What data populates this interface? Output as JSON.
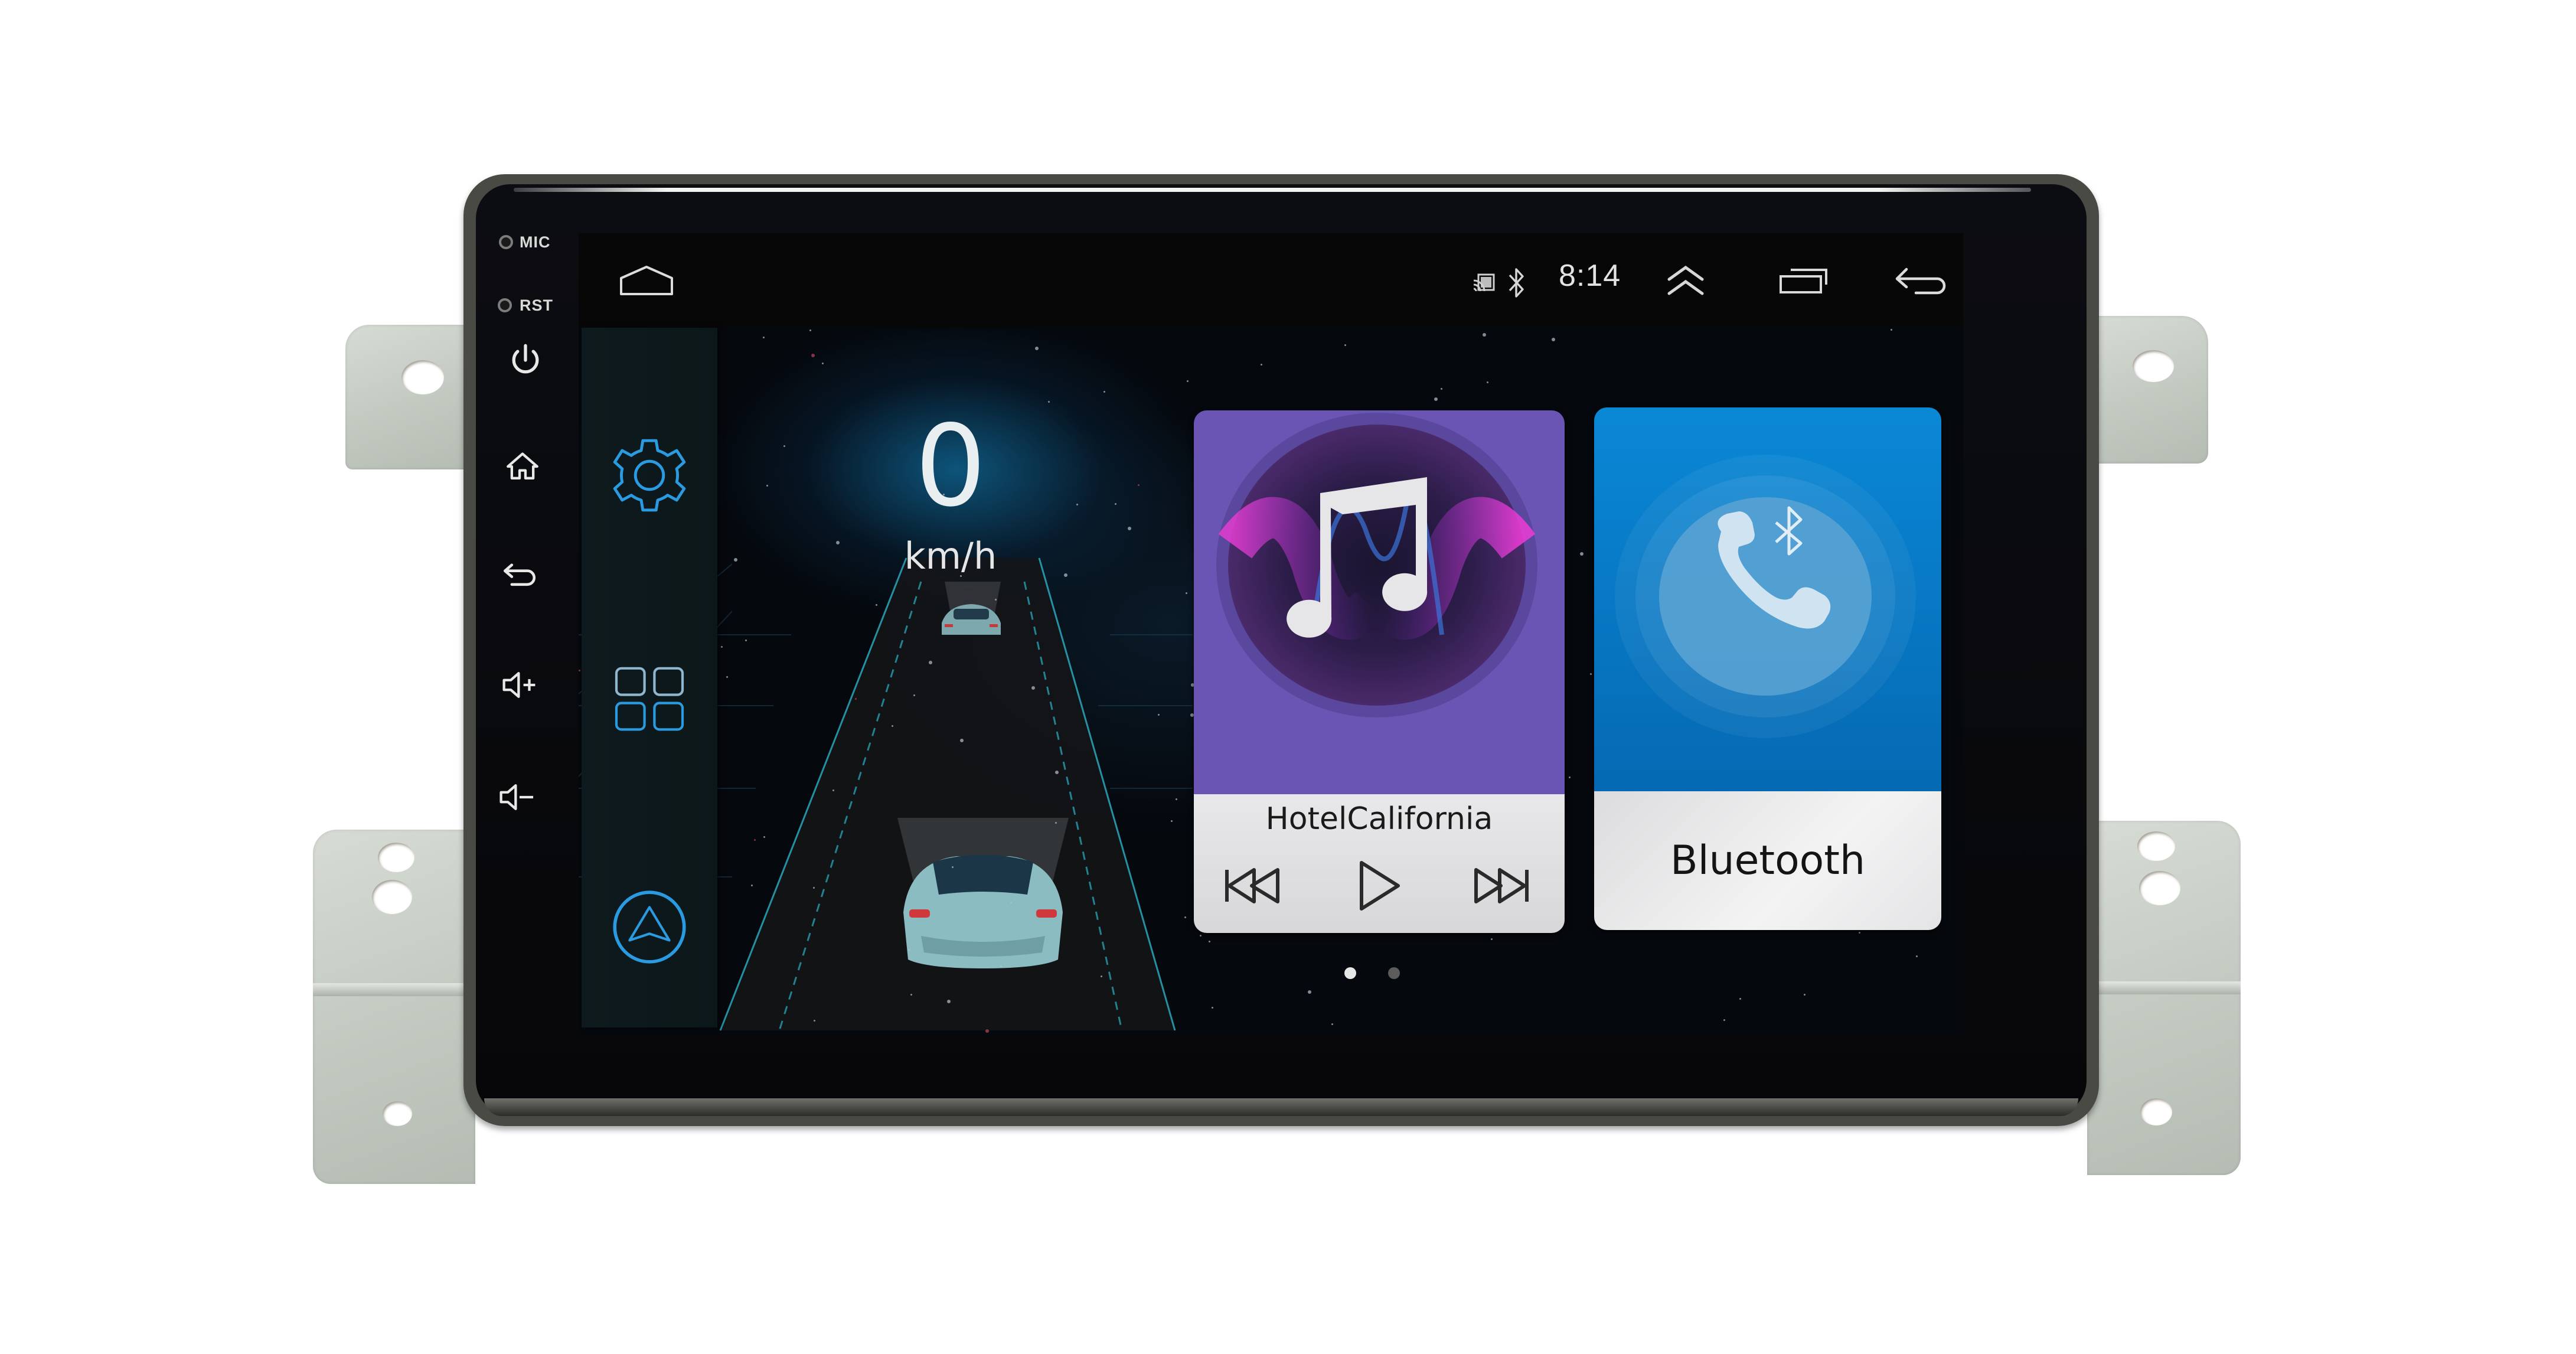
{
  "bezel": {
    "mic_label": "MIC",
    "rst_label": "RST",
    "buttons": [
      {
        "name": "power",
        "icon": "power-icon"
      },
      {
        "name": "home",
        "icon": "home-icon"
      },
      {
        "name": "back",
        "icon": "back-icon"
      },
      {
        "name": "volume-up",
        "icon": "volume-up-icon"
      },
      {
        "name": "volume-down",
        "icon": "volume-down-icon"
      }
    ]
  },
  "status_bar": {
    "home_icon": "home-outline-icon",
    "cast_icon": "cast-icon",
    "bluetooth_icon": "bluetooth-icon",
    "time": "8:14",
    "expand_icon": "double-chevron-up-icon",
    "recents_icon": "recent-apps-icon",
    "back_icon": "back-icon"
  },
  "dock": {
    "items": [
      {
        "name": "settings",
        "icon": "gear-icon"
      },
      {
        "name": "apps",
        "icon": "apps-grid-icon"
      },
      {
        "name": "navigation",
        "icon": "navigation-icon"
      }
    ],
    "accent_color": "#2a9be0"
  },
  "speed_widget": {
    "value": "0",
    "unit": "km/h"
  },
  "music_card": {
    "track_title": "HotelCalifornia",
    "controls": [
      "previous",
      "play",
      "next"
    ],
    "color": "#6a55b4"
  },
  "bluetooth_card": {
    "label": "Bluetooth",
    "icon": "phone-bluetooth-icon",
    "color": "#0a88d6"
  },
  "pager": {
    "page_count": 2,
    "active_page": 1
  }
}
